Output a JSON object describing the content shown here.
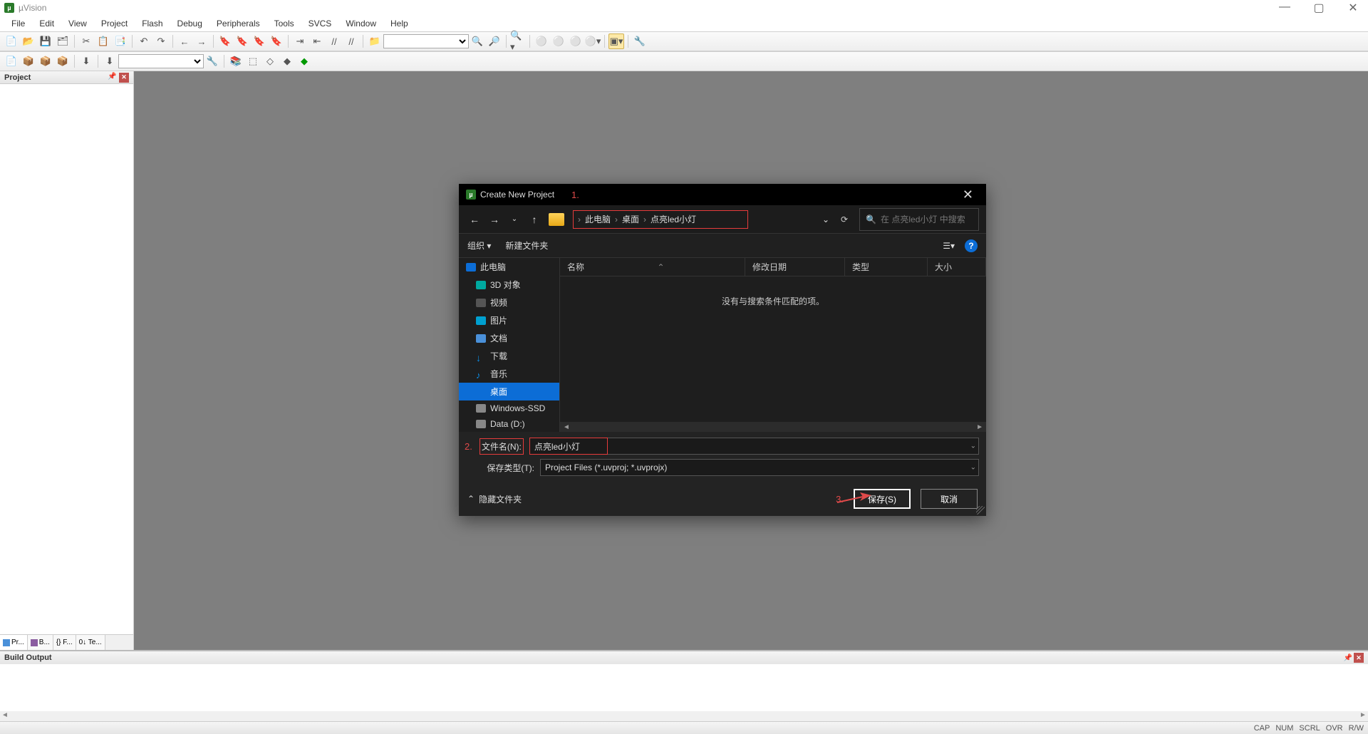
{
  "app": {
    "title": "µVision"
  },
  "menu": [
    "File",
    "Edit",
    "View",
    "Project",
    "Flash",
    "Debug",
    "Peripherals",
    "Tools",
    "SVCS",
    "Window",
    "Help"
  ],
  "panels": {
    "project_title": "Project",
    "tabs": [
      {
        "icon": "proj",
        "label": "Pr..."
      },
      {
        "icon": "books",
        "label": "B..."
      },
      {
        "icon": "func",
        "label": "{} F..."
      },
      {
        "icon": "tmpl",
        "label": "0↓ Te..."
      }
    ],
    "build_title": "Build Output"
  },
  "statusbar": {
    "cap": "CAP",
    "num": "NUM",
    "scrl": "SCRL",
    "ovr": "OVR",
    "rw": "R/W"
  },
  "dialog": {
    "title": "Create New Project",
    "breadcrumb": [
      "此电脑",
      "桌面",
      "点亮led小灯"
    ],
    "search_placeholder": "在 点亮led小灯 中搜索",
    "refresh_dropdown": "⌄",
    "organize": "组织 ▾",
    "new_folder": "新建文件夹",
    "view_btn": "☰▾",
    "tree": [
      {
        "label": "此电脑",
        "ico": "ico-pc",
        "root": true
      },
      {
        "label": "3D 对象",
        "ico": "ico-3d"
      },
      {
        "label": "视频",
        "ico": "ico-video"
      },
      {
        "label": "图片",
        "ico": "ico-pic"
      },
      {
        "label": "文档",
        "ico": "ico-doc"
      },
      {
        "label": "下载",
        "ico": "ico-dl"
      },
      {
        "label": "音乐",
        "ico": "ico-music"
      },
      {
        "label": "桌面",
        "ico": "ico-desk",
        "selected": true
      },
      {
        "label": "Windows-SSD",
        "ico": "ico-disk"
      },
      {
        "label": "Data (D:)",
        "ico": "ico-disk"
      }
    ],
    "columns": {
      "name": "名称",
      "date": "修改日期",
      "type": "类型",
      "size": "大小"
    },
    "empty_msg": "没有与搜索条件匹配的项。",
    "filename_label": "文件名(N):",
    "filename_value": "点亮led小灯",
    "filetype_label": "保存类型(T):",
    "filetype_value": "Project Files (*.uvproj; *.uvprojx)",
    "hide_folders": "隐藏文件夹",
    "save": "保存(S)",
    "cancel": "取消"
  },
  "annotations": {
    "a1": "1.",
    "a2": "2.",
    "a3": "3."
  }
}
